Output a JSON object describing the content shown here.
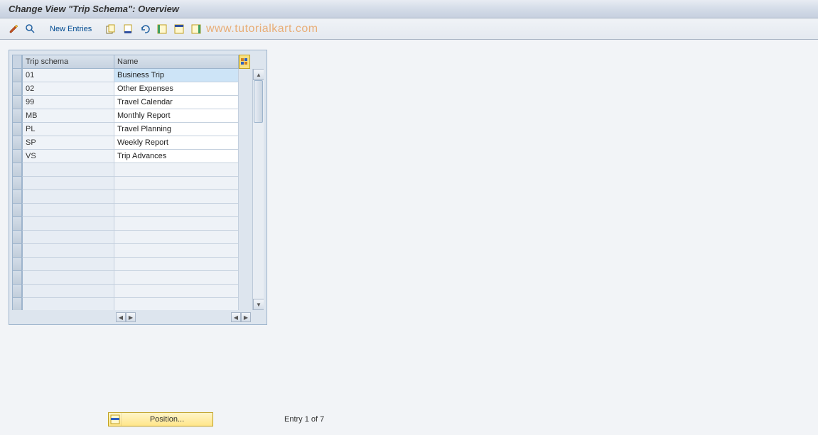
{
  "title": "Change View \"Trip Schema\": Overview",
  "toolbar": {
    "new_entries": "New Entries"
  },
  "watermark": "www.tutorialkart.com",
  "table": {
    "headers": {
      "code": "Trip schema",
      "name": "Name"
    },
    "rows": [
      {
        "code": "01",
        "name": "Business Trip",
        "selected": true
      },
      {
        "code": "02",
        "name": "Other Expenses",
        "selected": false
      },
      {
        "code": "99",
        "name": "Travel Calendar",
        "selected": false
      },
      {
        "code": "MB",
        "name": "Monthly Report",
        "selected": false
      },
      {
        "code": "PL",
        "name": "Travel Planning",
        "selected": false
      },
      {
        "code": "SP",
        "name": "Weekly Report",
        "selected": false
      },
      {
        "code": "VS",
        "name": "Trip Advances",
        "selected": false
      }
    ],
    "empty_rows": 11
  },
  "footer": {
    "position_label": "Position...",
    "entry_status": "Entry 1 of 7"
  }
}
